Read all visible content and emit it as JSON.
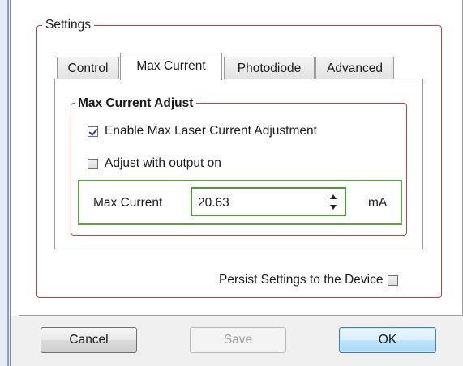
{
  "settings_group": {
    "title": "Settings"
  },
  "tabs": [
    {
      "label": "Control",
      "selected": false
    },
    {
      "label": "Max Current",
      "selected": true
    },
    {
      "label": "Photodiode",
      "selected": false
    },
    {
      "label": "Advanced",
      "selected": false
    }
  ],
  "max_current_group": {
    "title": "Max Current Adjust",
    "enable_checkbox": {
      "label": "Enable Max Laser Current Adjustment",
      "checked": true
    },
    "output_checkbox": {
      "label": "Adjust with output on",
      "checked": false
    },
    "field": {
      "label": "Max Current",
      "value": "20.63",
      "unit": "mA"
    }
  },
  "persist": {
    "label": "Persist Settings to the Device",
    "checked": false
  },
  "buttons": {
    "cancel": "Cancel",
    "save": "Save",
    "ok": "OK"
  },
  "colors": {
    "group_border": "#c0403f",
    "field_border": "#63a043",
    "ok_button_border": "#3c7fb1"
  }
}
